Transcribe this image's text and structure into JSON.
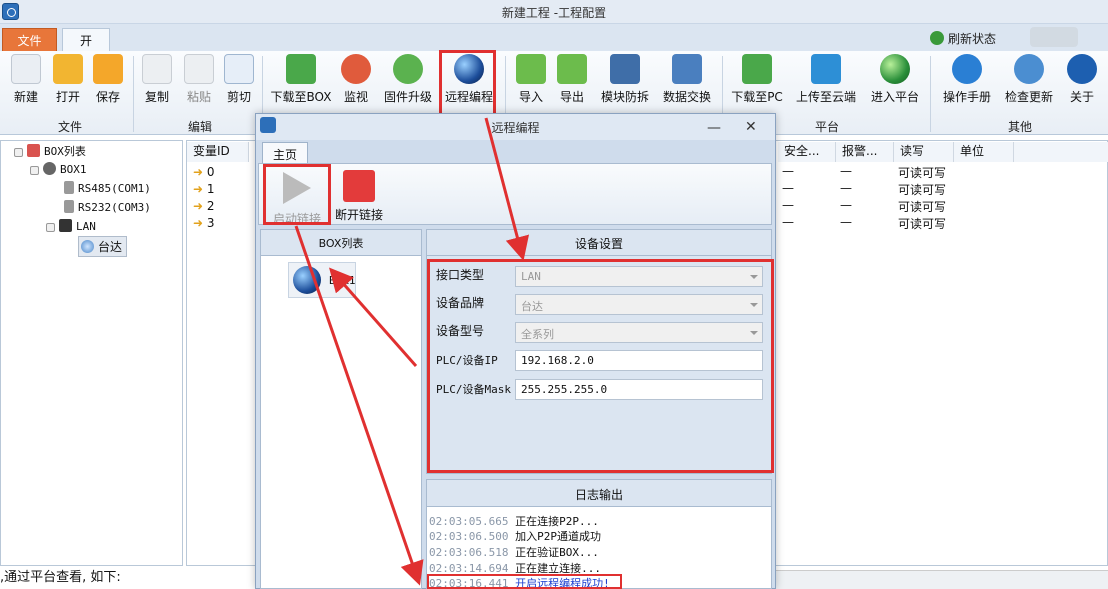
{
  "window": {
    "title": "新建工程 -工程配置"
  },
  "ribbon_tabs": {
    "file": "文件",
    "home": "开始"
  },
  "header": {
    "refresh_status": "刷新状态"
  },
  "ribbon": {
    "buttons": {
      "new": "新建",
      "open": "打开",
      "save": "保存",
      "copy": "复制",
      "paste": "粘贴",
      "cut": "剪切",
      "download_box": "下载至BOX",
      "monitor": "监视",
      "firmware": "固件升级",
      "remote": "远程编程",
      "import": "导入",
      "export": "导出",
      "module_protect": "模块防拆",
      "data_exchange": "数据交换",
      "download_pc": "下载至PC",
      "upload_cloud": "上传至云端",
      "enter_platform": "进入平台",
      "manual": "操作手册",
      "check_update": "检查更新",
      "about": "关于"
    },
    "groups": {
      "file": "文件",
      "edit": "编辑",
      "platform": "平台",
      "other": "其他"
    }
  },
  "tree": {
    "root": "BOX列表",
    "box": "BOX1",
    "rs485": "RS485(COM1)",
    "rs232": "RS232(COM3)",
    "lan": "LAN",
    "device": "台达"
  },
  "grid": {
    "headers": {
      "var_id": "变量ID",
      "safety": "安全...",
      "alarm": "报警...",
      "rw": "读写",
      "unit": "单位"
    },
    "rows": [
      {
        "id": "0",
        "safety": "—",
        "alarm": "—",
        "rw": "可读可写"
      },
      {
        "id": "1",
        "safety": "—",
        "alarm": "—",
        "rw": "可读可写"
      },
      {
        "id": "2",
        "safety": "—",
        "alarm": "—",
        "rw": "可读可写"
      },
      {
        "id": "3",
        "safety": "—",
        "alarm": "—",
        "rw": "可读可写"
      }
    ]
  },
  "dialog": {
    "title": "远程编程",
    "tab": "主页",
    "start_link": "启动链接",
    "stop_link": "断开链接",
    "boxlist_title": "BOX列表",
    "box_item": "BOX1",
    "device_settings": {
      "title": "设备设置",
      "interface_label": "接口类型",
      "interface_value": "LAN",
      "brand_label": "设备品牌",
      "brand_value": "台达",
      "model_label": "设备型号",
      "model_value": "全系列",
      "ip_label": "PLC/设备IP",
      "ip_value": "192.168.2.0",
      "mask_label": "PLC/设备Mask",
      "mask_value": "255.255.255.0"
    },
    "log": {
      "title": "日志输出",
      "lines": [
        {
          "time": "02:03:05.665",
          "text": "正在连接P2P..."
        },
        {
          "time": "02:03:06.500",
          "text": "加入P2P通道成功"
        },
        {
          "time": "02:03:06.518",
          "text": "正在验证BOX..."
        },
        {
          "time": "02:03:14.694",
          "text": "正在建立连接..."
        },
        {
          "time": "02:03:16.441",
          "text": "开启远程编程成功!"
        }
      ]
    }
  },
  "caption": ",通过平台查看, 如下:",
  "colors": {
    "accent_red": "#e03030",
    "file_tab": "#e8763a",
    "log_highlight": "#1a3ed0"
  }
}
